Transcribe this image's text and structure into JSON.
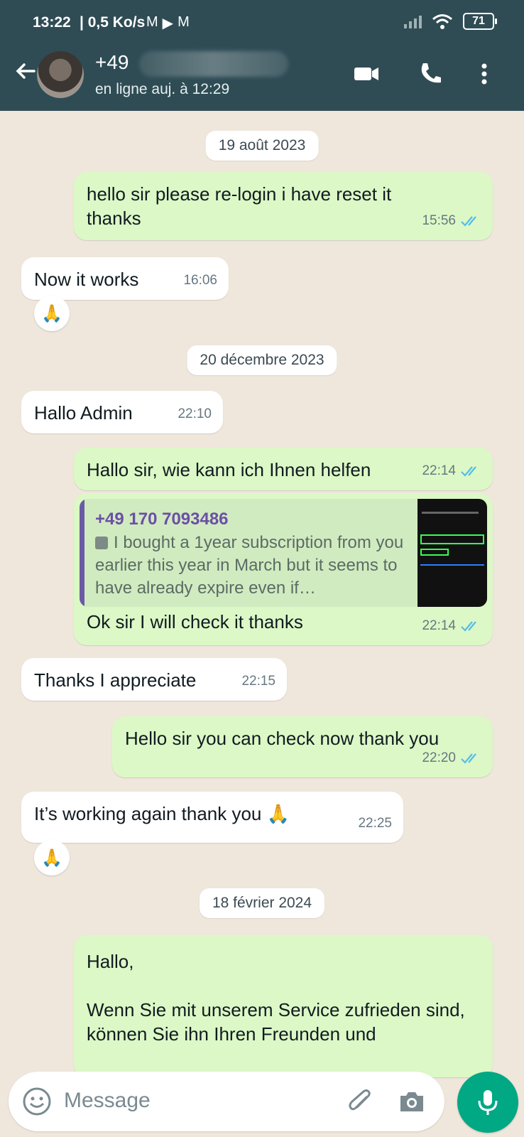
{
  "status_bar": {
    "time": "13:22",
    "network": "| 0,5 Ko/s",
    "battery": "71"
  },
  "header": {
    "contact": "+49",
    "status": "en ligne auj. à 12:29"
  },
  "chat": {
    "dates": [
      "19 août 2023",
      "20 décembre 2023",
      "18 février 2024"
    ],
    "messages": [
      {
        "text": "hello sir please re-login i have reset it thanks",
        "time": "15:56"
      },
      {
        "text": "Now it works",
        "time": "16:06",
        "reaction": "🙏"
      },
      {
        "text": "Hallo Admin",
        "time": "22:10"
      },
      {
        "text": "Hallo sir, wie kann ich Ihnen helfen",
        "time": "22:14"
      },
      {
        "quote_name": "+49 170 7093486",
        "quote_text": "I bought a 1year subscription from you earlier this year in March but it seems to have already expire even if…",
        "text": "Ok sir I will check it thanks",
        "time": "22:14"
      },
      {
        "text": "Thanks I appreciate",
        "time": "22:15"
      },
      {
        "text": "Hello sir you can check now thank you",
        "time": "22:20"
      },
      {
        "text": "It’s working again thank you 🙏",
        "time": "22:25",
        "reaction": "🙏"
      },
      {
        "line1": "Hallo,",
        "line2": "Wenn Sie mit unserem Service zufrieden sind, können Sie ihn Ihren Freunden und"
      }
    ]
  },
  "composer": {
    "placeholder": "Message"
  },
  "colors": {
    "header": "#2f4c55",
    "outgoing": "#dcf8c6",
    "incoming": "#ffffff",
    "accent": "#00a884"
  }
}
